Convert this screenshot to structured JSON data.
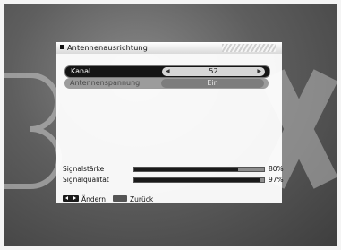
{
  "panel": {
    "title": "Antennenausrichtung"
  },
  "rows": [
    {
      "label": "Kanal",
      "value": "52"
    },
    {
      "label": "Antennenspannung",
      "value": "Ein"
    }
  ],
  "signals": [
    {
      "label": "Signalstärke",
      "percent": "80%",
      "level": 0.8
    },
    {
      "label": "Signalqualität",
      "percent": "97%",
      "level": 0.97
    }
  ],
  "help": {
    "change_label": "Ändern",
    "back_label": "Zurück"
  },
  "colors": {
    "accent": "#151515",
    "bar_fill": "#1a1a1a",
    "bar_track": "#8e8e8e"
  }
}
